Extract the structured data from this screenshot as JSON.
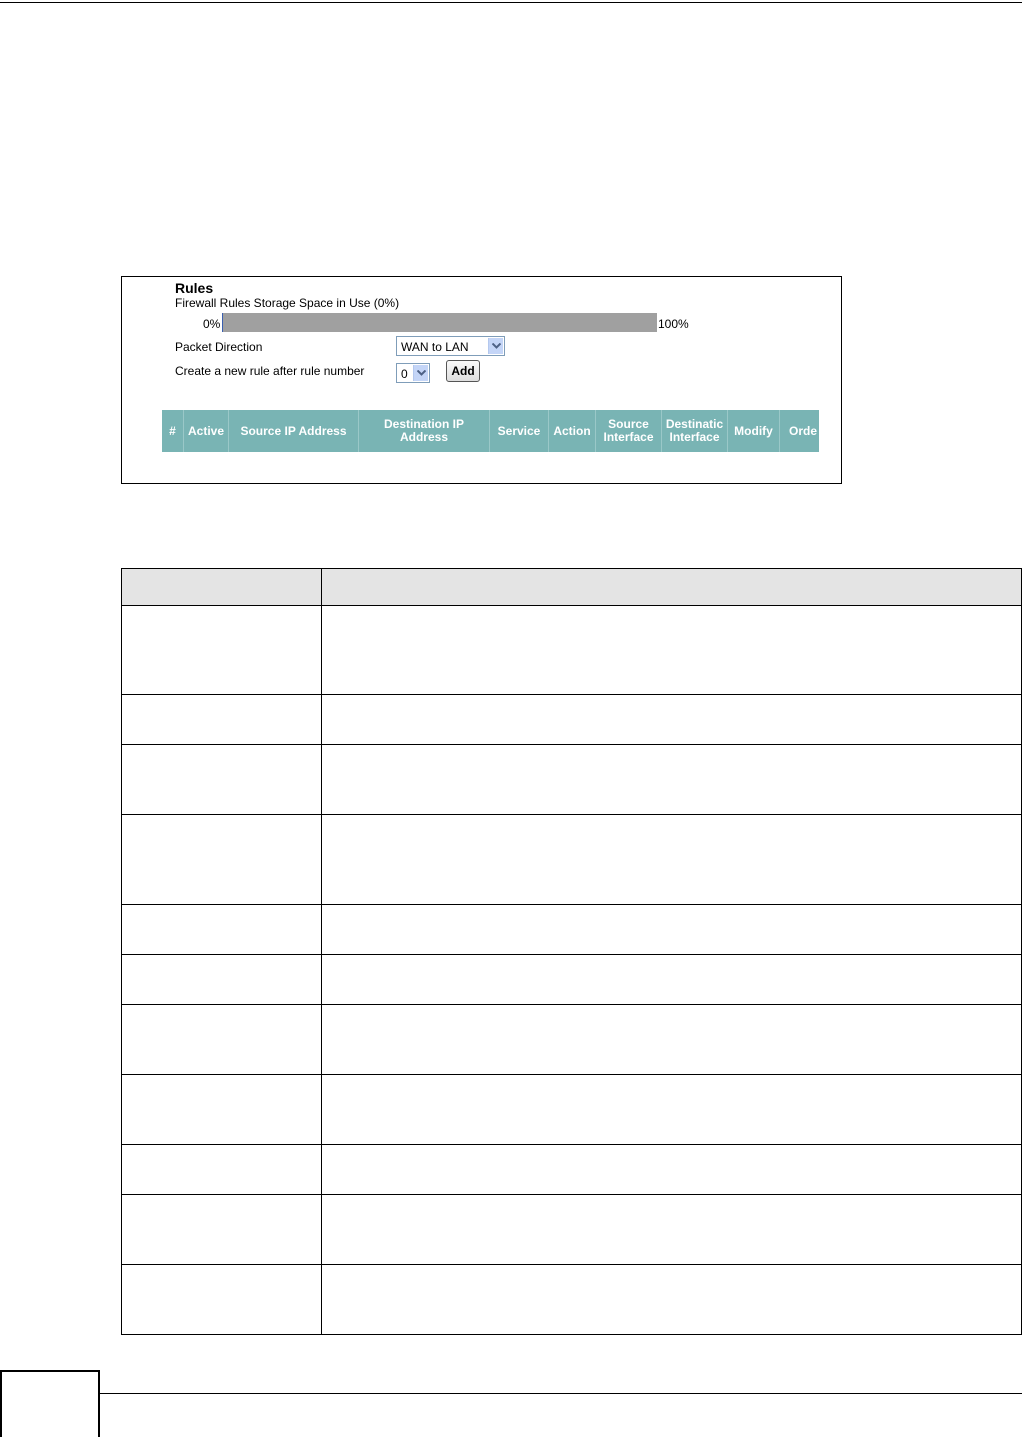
{
  "screenshot": {
    "title": "Rules",
    "storage_label": "Firewall Rules Storage Space in Use (0%)",
    "storage_min": "0%",
    "storage_max": "100%",
    "storage_used_fraction": 0.0,
    "packet_direction_label": "Packet Direction",
    "packet_direction_value": "WAN to LAN",
    "new_rule_label": "Create a new rule after rule number",
    "rule_number_value": "0",
    "add_label": "Add",
    "columns": [
      "#",
      "Active",
      "Source IP Address",
      "Destination IP Address",
      "Service",
      "Action",
      "Source Interface",
      "Destinatic Interface",
      "Modify",
      "Orde"
    ],
    "header_color": "#79b4b4"
  },
  "description_table": {
    "headers": [
      "",
      ""
    ],
    "rows": [
      {
        "label": "",
        "description": ""
      },
      {
        "label": "",
        "description": ""
      },
      {
        "label": "",
        "description": ""
      },
      {
        "label": "",
        "description": ""
      },
      {
        "label": "",
        "description": ""
      },
      {
        "label": "",
        "description": ""
      },
      {
        "label": "",
        "description": ""
      },
      {
        "label": "",
        "description": ""
      },
      {
        "label": "",
        "description": ""
      },
      {
        "label": "",
        "description": ""
      },
      {
        "label": "",
        "description": ""
      }
    ]
  }
}
